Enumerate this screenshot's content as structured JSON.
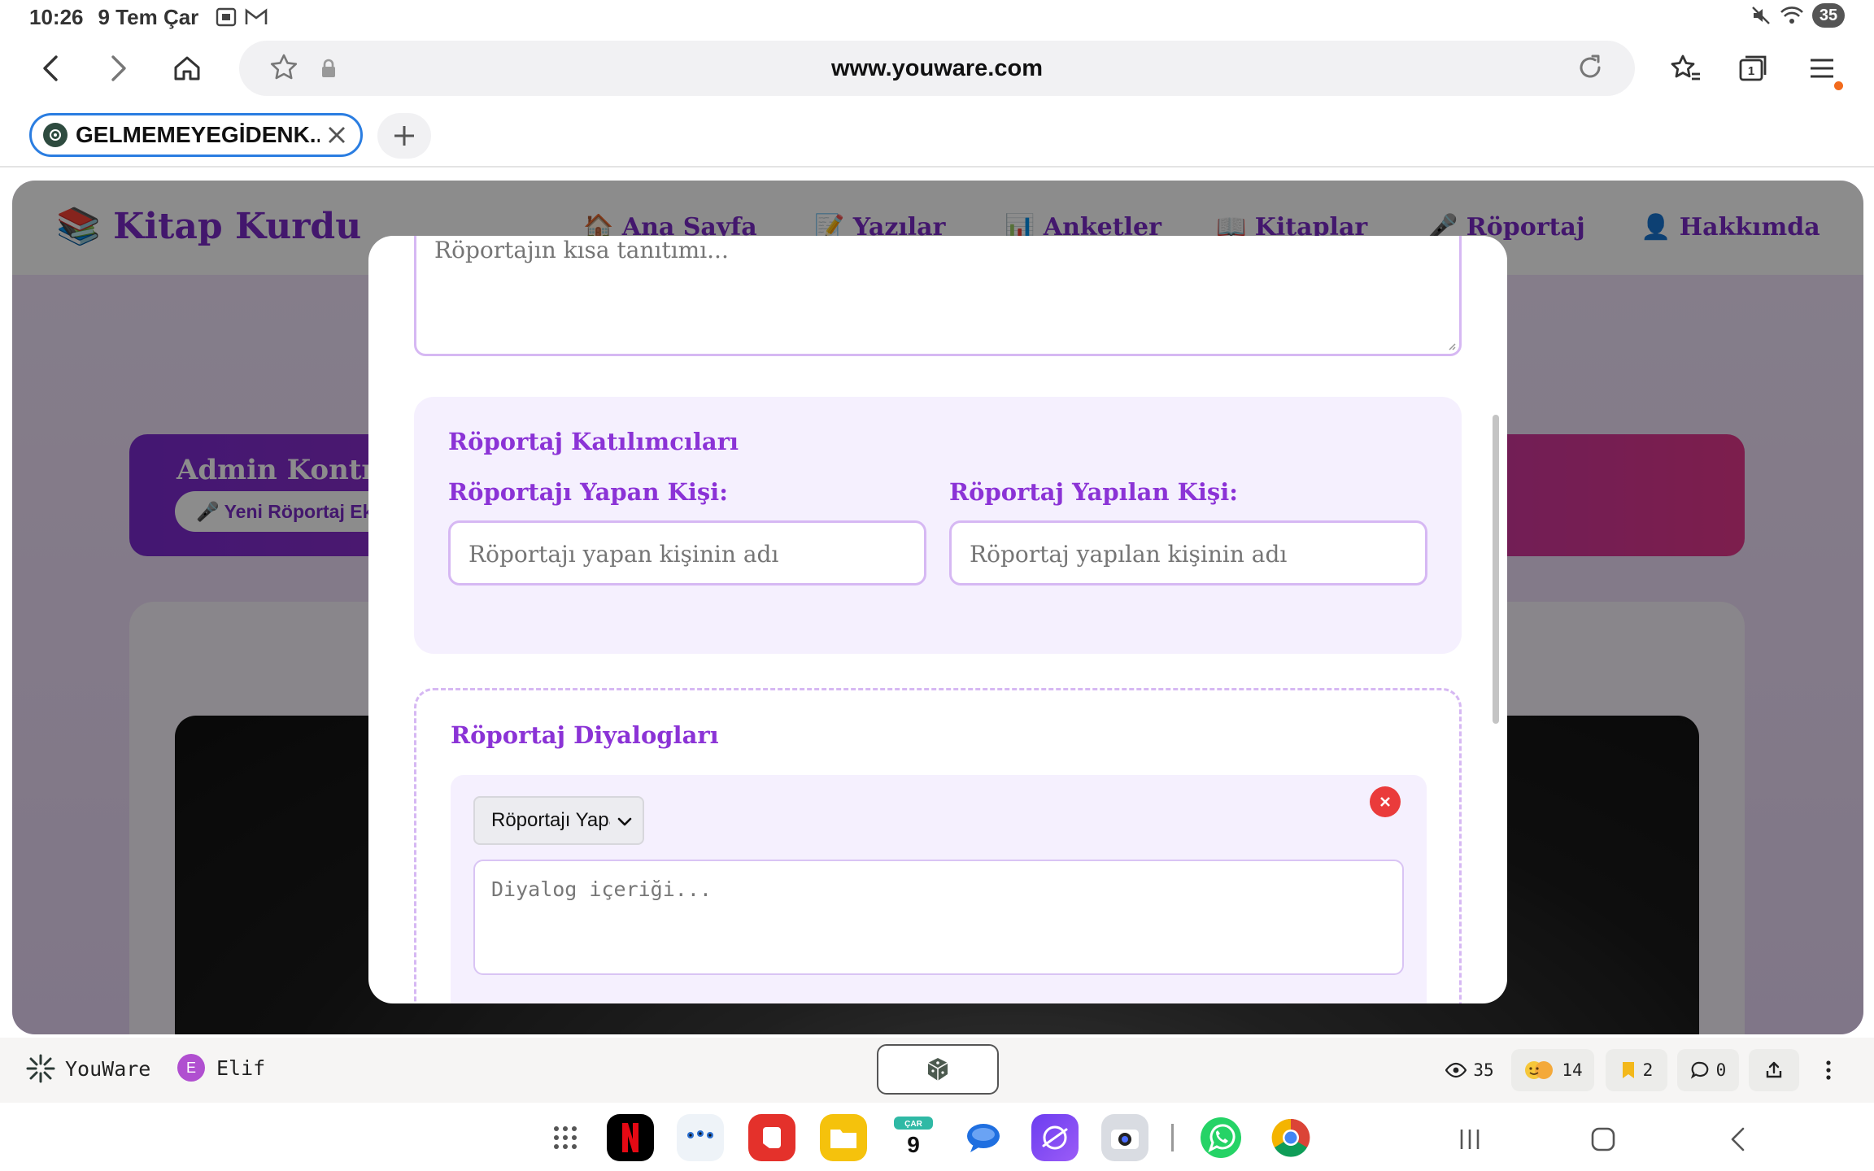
{
  "status_bar": {
    "time": "10:26",
    "date": "9 Tem Çar",
    "battery": "35"
  },
  "browser": {
    "url": "www.youware.com",
    "tab_title": "GELMEMEYEGİDENK...",
    "tab_count": "1"
  },
  "site": {
    "logo": "📚 Kitap Kurdu",
    "nav": [
      {
        "label": "🏠 Ana Sayfa"
      },
      {
        "label": "📝 Yazılar"
      },
      {
        "label": "📊 Anketler"
      },
      {
        "label": "📖 Kitaplar"
      },
      {
        "label": "🎤 Röportaj"
      },
      {
        "label": "👤 Hakkımda"
      }
    ],
    "admin_title": "Admin Kontrol",
    "admin_button": "🎤 Yeni Röportaj Ekle"
  },
  "modal": {
    "intro_placeholder": "Röportajın kısa tanıtımı...",
    "participants_title": "Röportaj Katılımcıları",
    "interviewer_label": "Röportajı Yapan Kişi:",
    "interviewer_placeholder": "Röportajı yapan kişinin adı",
    "interviewee_label": "Röportaj Yapılan Kişi:",
    "interviewee_placeholder": "Röportaj yapılan kişinin adı",
    "dialogs_title": "Röportaj Diyalogları",
    "speaker_selected": "Röportajı Yapan",
    "dialog_placeholder": "Diyalog içeriği..."
  },
  "youware_bar": {
    "brand": "YouWare",
    "user_initial": "E",
    "user_name": "Elif",
    "views": "35",
    "reactions": "14",
    "bookmarks": "2",
    "comments": "0"
  },
  "dock": {
    "calendar_day_label": "ÇAR",
    "calendar_day": "9"
  },
  "colors": {
    "accent_purple": "#8b33d6",
    "tab_border": "#2a7de1",
    "remove_red": "#ea3b3b",
    "panel_gradient_end": "#e3388c"
  }
}
